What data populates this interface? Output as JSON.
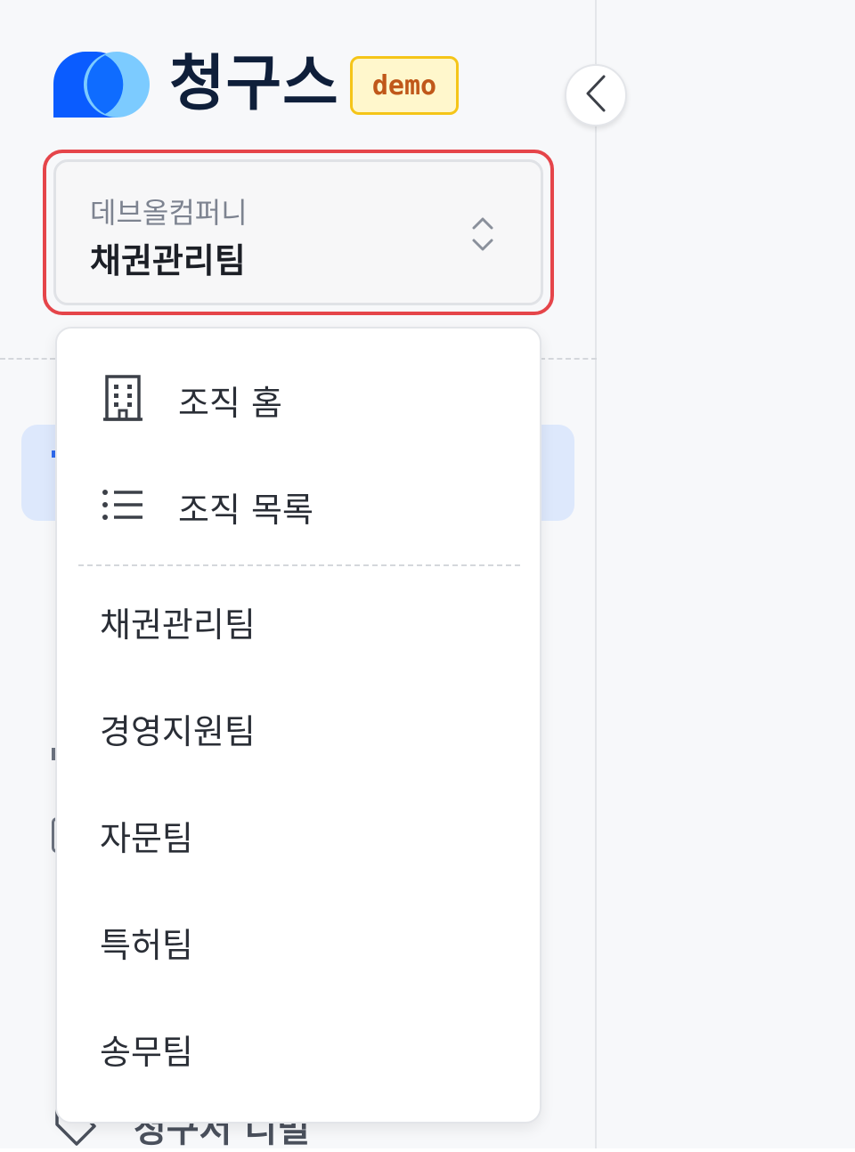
{
  "brand": {
    "name": "청구스",
    "badge": "demo",
    "logo_icon": "logo-mark-icon",
    "colors": {
      "logo_primary": "#0a5cff",
      "logo_secondary": "#7ccbff",
      "badge_border": "#f5c518",
      "badge_text": "#c0581a"
    }
  },
  "sidebar": {
    "collapse_icon": "chevron-left-icon"
  },
  "org_selector": {
    "company": "데브올컴퍼니",
    "team": "채권관리팀",
    "icon": "chevron-up-down-icon",
    "highlight_color": "#e5454a"
  },
  "dropdown": {
    "actions": [
      {
        "label": "조직 홈",
        "icon": "building-icon"
      },
      {
        "label": "조직 목록",
        "icon": "list-icon"
      }
    ],
    "teams": [
      "채권관리팀",
      "경영지원팀",
      "자문팀",
      "특허팀",
      "송무팀"
    ]
  },
  "nav": {
    "active_bg_color": "#dde8fc",
    "bottom_item": {
      "label": "청구서 디벌",
      "icon": "tag-icon"
    }
  }
}
